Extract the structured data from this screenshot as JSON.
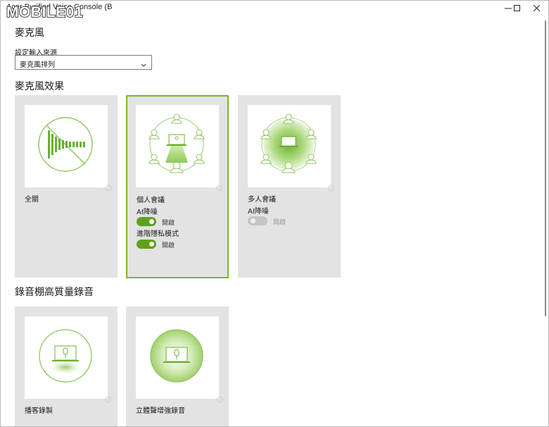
{
  "window": {
    "title": "Acer Purified Voice Console (B",
    "watermark": "MOBILE01",
    "controls": [
      "minimize",
      "maximize",
      "close"
    ]
  },
  "page": {
    "heading": "麥克風",
    "input_source_label": "設定輸入來源",
    "input_source_value": "麥克風排列"
  },
  "effects": {
    "heading": "麥克風效果",
    "cards": [
      {
        "id": "off",
        "title": "全關",
        "icon": "mute-wave-icon",
        "selected": false
      },
      {
        "id": "personal",
        "title": "個人會議",
        "icon": "personal-meeting-icon",
        "selected": true,
        "options": [
          {
            "label": "AI降噪",
            "state": "on",
            "state_text": "開啟"
          },
          {
            "label": "進階隱私模式",
            "state": "on",
            "state_text": "開啟"
          }
        ]
      },
      {
        "id": "group",
        "title": "多人會議",
        "icon": "group-meeting-icon",
        "selected": false,
        "options": [
          {
            "label": "AI降噪",
            "state": "disabled",
            "state_text": "開啟"
          }
        ]
      }
    ]
  },
  "studio": {
    "heading": "錄音棚高質量錄音",
    "cards": [
      {
        "id": "podcast",
        "title": "播客錄製",
        "icon": "podcast-mic-icon"
      },
      {
        "id": "stereo",
        "title": "立體聲增強錄音",
        "icon": "stereo-mic-icon"
      }
    ]
  },
  "colors": {
    "accent": "#7ab82a",
    "toggle_on": "#5da21a",
    "card_bg": "#e3e3e3",
    "toggle_off": "#c5c5c5"
  }
}
